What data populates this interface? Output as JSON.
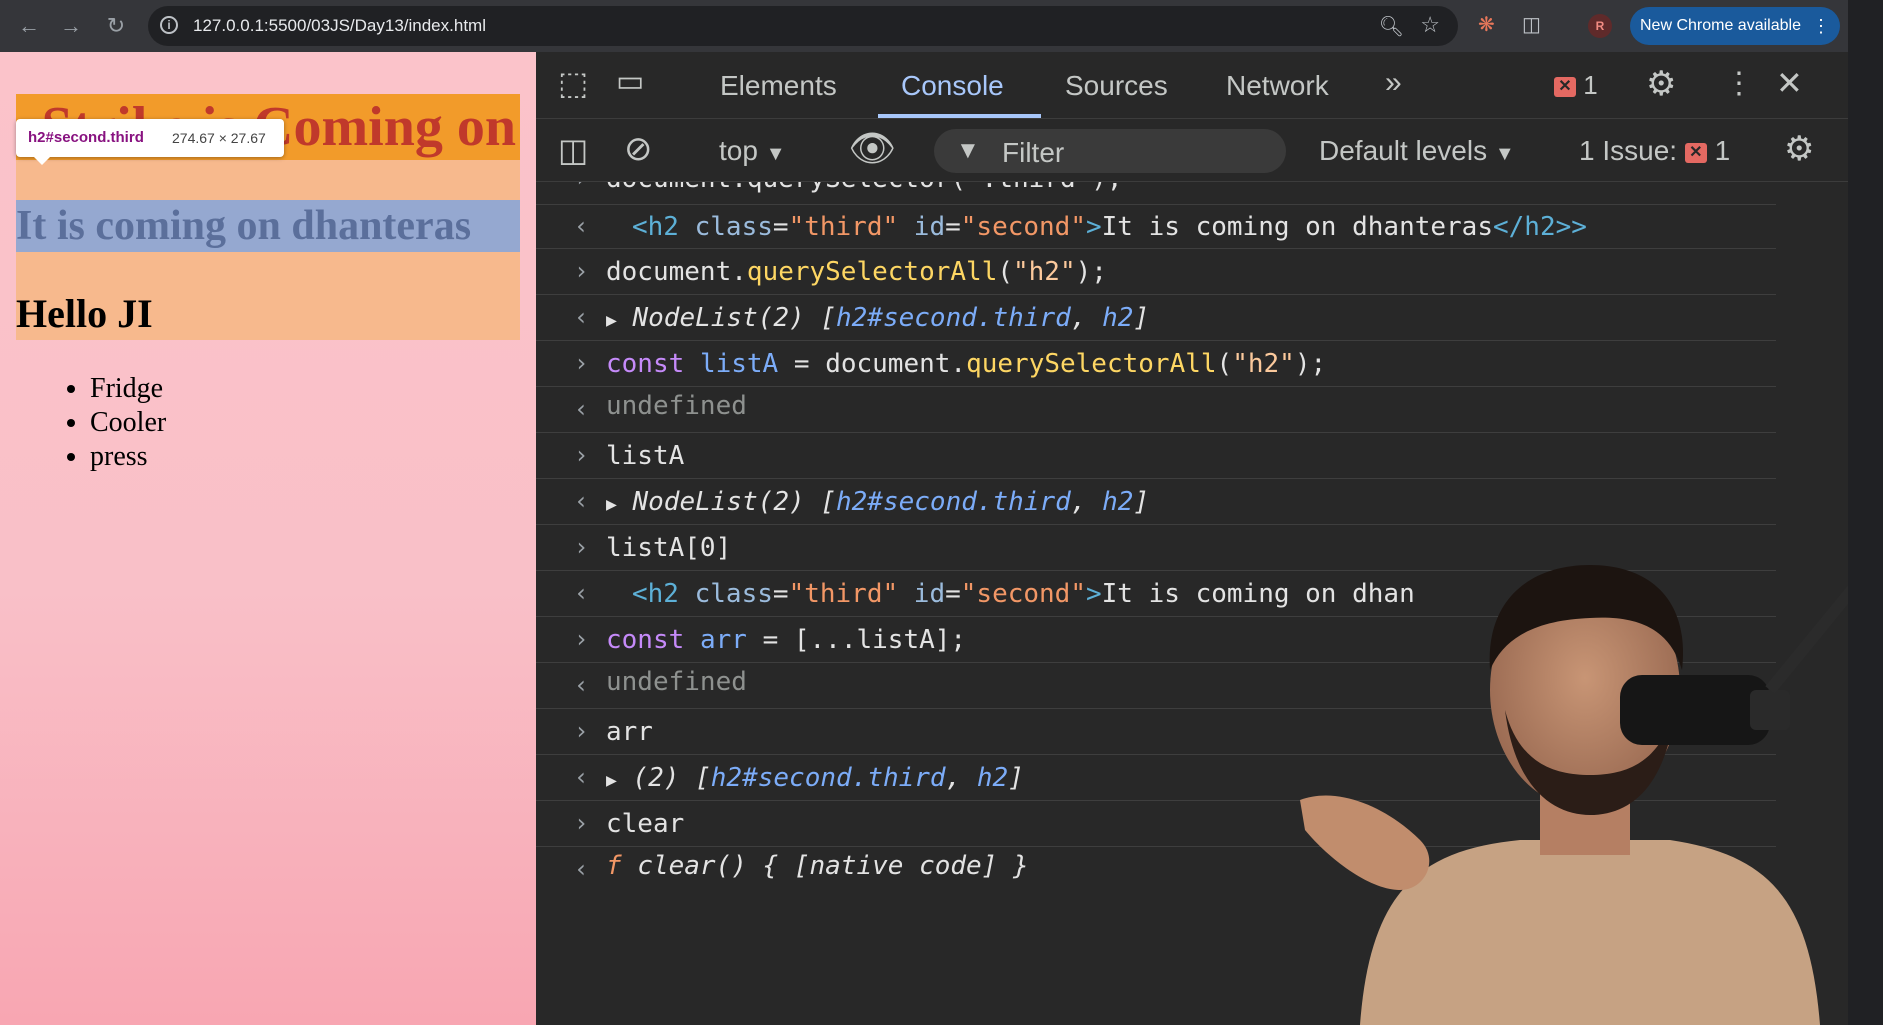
{
  "browser": {
    "url": "127.0.0.1:5500/03JS/Day13/index.html",
    "new_chrome": "New Chrome available",
    "profile_initial": "R"
  },
  "page": {
    "heading_strike": "Strike is Coming on",
    "tooltip_selector": "h2#second.third",
    "tooltip_dims": "274.67 × 27.67",
    "heading_second": "It is coming on dhanteras",
    "heading_hello": "Hello JI",
    "list_items": [
      "Fridge",
      "Cooler",
      "press"
    ]
  },
  "devtools": {
    "tabs": [
      "Elements",
      "Console",
      "Sources",
      "Network"
    ],
    "active_tab": "Console",
    "error_count": "1",
    "context": "top",
    "filter_placeholder": "Filter",
    "levels": "Default levels",
    "issues_label": "1 Issue:",
    "issues_count": "1",
    "colors": {
      "accent": "#a8c7fa",
      "error": "#e46962"
    }
  },
  "console": {
    "partial_top": "document.querySelector(\".third\");",
    "out1": {
      "tag_open": "<h2",
      "attr1_name": "class",
      "attr1_val": "\"third\"",
      "attr2_name": "id",
      "attr2_val": "\"second\"",
      "text": "It is coming on dhanteras",
      "tag_close": "</h2>"
    },
    "in2": {
      "obj": "document",
      "fn": "querySelectorAll",
      "arg": "\"h2\"",
      "end": ");"
    },
    "out2": {
      "label": "NodeList(2)",
      "item1": "h2#second.third",
      "item2": "h2"
    },
    "in3": {
      "kw": "const",
      "var": "listA",
      "obj": "document",
      "fn": "querySelectorAll",
      "arg": "\"h2\"",
      "end": ");"
    },
    "out3": "undefined",
    "in4": "listA",
    "out4": {
      "label": "NodeList(2)",
      "item1": "h2#second.third",
      "item2": "h2"
    },
    "in5": "listA[0]",
    "out5": {
      "tag_open": "<h2",
      "attr1_name": "class",
      "attr1_val": "\"third\"",
      "attr2_name": "id",
      "attr2_val": "\"second\"",
      "text": "It is coming on dhan"
    },
    "in6": {
      "kw": "const",
      "var": "arr",
      "rest": "= [...listA];"
    },
    "out6": "undefined",
    "in7": "arr",
    "out7": {
      "label": "(2)",
      "item1": "h2#second.third",
      "item2": "h2"
    },
    "in8": "clear",
    "out8": {
      "f": "f",
      "sig": "clear() { [native code] }"
    }
  }
}
